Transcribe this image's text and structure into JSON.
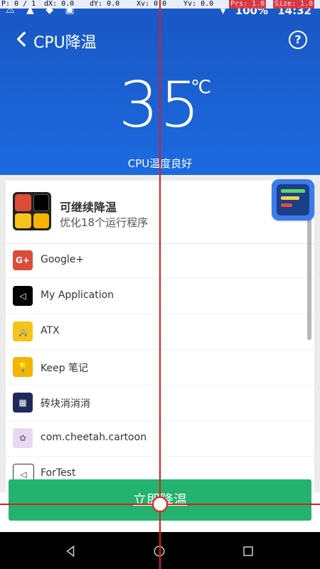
{
  "debug": {
    "p": "P: 0 / 1",
    "dx": "dX: 0.0",
    "dy": "dY: 0.0",
    "xv": "Xv: 0.0",
    "yv": "Yv: 0.0",
    "prs": "Prs: 1.0",
    "size": "Size: 1.0"
  },
  "status_bar": {
    "battery": "100%",
    "time": "14:32"
  },
  "header": {
    "title": "CPU降温",
    "temperature": "35",
    "unit": "℃",
    "status": "CPU温度良好"
  },
  "summary": {
    "title": "可继续降温",
    "subtitle": "优化18个运行程序"
  },
  "apps": [
    {
      "name": "Google+",
      "icon": "google-plus-icon",
      "color": "#dd4b39"
    },
    {
      "name": "My Application",
      "icon": "unity-icon",
      "color": "#000000"
    },
    {
      "name": "ATX",
      "icon": "taxi-icon",
      "color": "#f6c31a"
    },
    {
      "name": "Keep 笔记",
      "icon": "bulb-icon",
      "color": "#f4b400"
    },
    {
      "name": "砖块消消消",
      "icon": "bricks-icon",
      "color": "#1e2a5a"
    },
    {
      "name": "com.cheetah.cartoon",
      "icon": "anime-icon",
      "color": "#e8d8f0"
    },
    {
      "name": "ForTest",
      "icon": "unity-icon",
      "color": "#ffffff"
    }
  ],
  "action_button": {
    "label": "立即降温"
  },
  "colors": {
    "header": "#1a59c7",
    "accent_button": "#23b36f"
  }
}
